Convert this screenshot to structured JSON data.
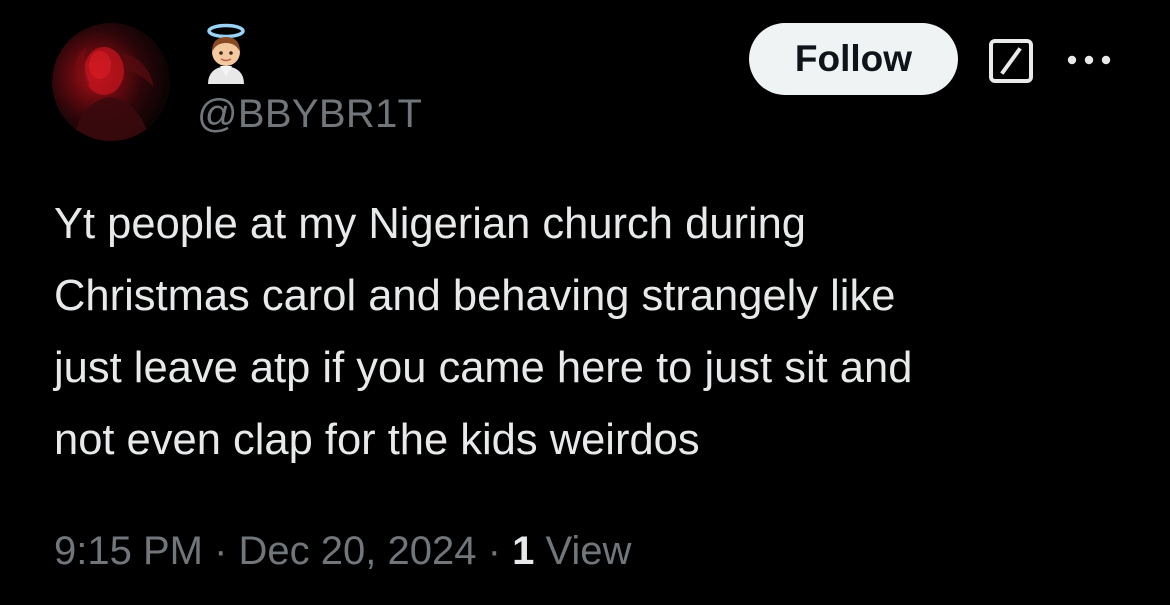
{
  "user": {
    "avatar_icon": "profile-photo",
    "name_emoji_icon": "angel-face-emoji",
    "handle": "@BBYBR1T"
  },
  "actions": {
    "follow_label": "Follow",
    "grok_icon": "slash-box-icon",
    "more_icon": "ellipsis-icon"
  },
  "tweet": {
    "lines": [
      "Yt people at my Nigerian church during",
      "Christmas carol and behaving strangely like",
      "just leave atp if you came here to just sit and",
      "not even clap for the kids weirdos"
    ]
  },
  "meta": {
    "time": "9:15 PM",
    "separator": "·",
    "date": "Dec 20, 2024",
    "views_count": "1",
    "views_label": "View"
  },
  "colors": {
    "background": "#000000",
    "text_primary": "#e7e9ea",
    "text_secondary": "#71767b",
    "button_bg": "#eff3f4",
    "button_text": "#0f1419"
  }
}
